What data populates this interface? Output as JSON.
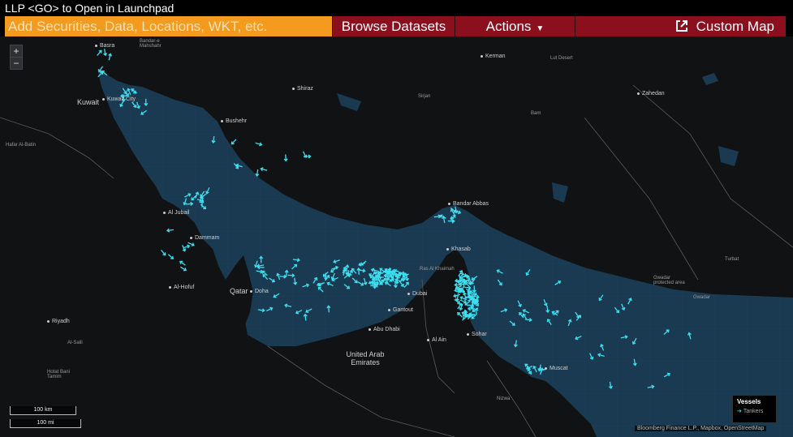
{
  "title_bar": {
    "text": "LLP <GO> to Open in Launchpad"
  },
  "toolbar": {
    "search_placeholder": "Add Securities, Data, Locations, WKT, etc.",
    "browse_label": "Browse Datasets",
    "actions_label": "Actions",
    "actions_caret": "▼",
    "custom_map_label": "Custom Map",
    "custom_map_icon": "external-link-icon"
  },
  "zoom": {
    "in": "+",
    "out": "−"
  },
  "scale_bar": {
    "km": "100 km",
    "mi": "100 mi"
  },
  "legend": {
    "title": "Vessels",
    "item": "Tankers",
    "item_color": "#3de0f0"
  },
  "attribution": "Bloomberg Finance L.P., Mapbox, OpenStreetMap",
  "colors": {
    "water": "#1a3a52",
    "land": "#111214",
    "vessel": "#3de0f0",
    "toolbar_red": "#8b0f1c",
    "search_orange": "#f39a1f"
  },
  "labels": {
    "basra": "Basra",
    "bandar_mahshahr": "Bandar-e Mahshahr",
    "kuwait": "Kuwait",
    "kuwait_city": "Kuwait City",
    "hafar": "Hafar Al-Batin",
    "bushehr": "Bushehr",
    "shiraz": "Shiraz",
    "kerman": "Kerman",
    "lut_desert": "Lut Desert",
    "sirjan": "Sirjan",
    "bam": "Bam",
    "zahedan": "Zahedan",
    "bandar_abbas": "Bandar Abbas",
    "khasab": "Khasab",
    "ras_al_khaimah": "Ras Al Khaimah",
    "dubai": "Dubai",
    "gantout": "Gantout",
    "abu_dhabi": "Abu Dhabi",
    "al_ain": "Al Ain",
    "sohar": "Sohar",
    "muscat": "Muscat",
    "uae": "United Arab Emirates",
    "al_jubail": "Al Jubail",
    "dammam": "Dammam",
    "al_hofuf": "Al-Hofuf",
    "qatar": "Qatar",
    "doha": "Doha",
    "riyadh": "Riyadh",
    "al_salil": "Al-Salil",
    "hotat_bani_tamim": "Hotat Bani Tamim",
    "nizwa": "Nizwa",
    "turbat": "Turbat",
    "gwadar": "Gwadar",
    "gwadar_area": "Gwadar protected area"
  }
}
